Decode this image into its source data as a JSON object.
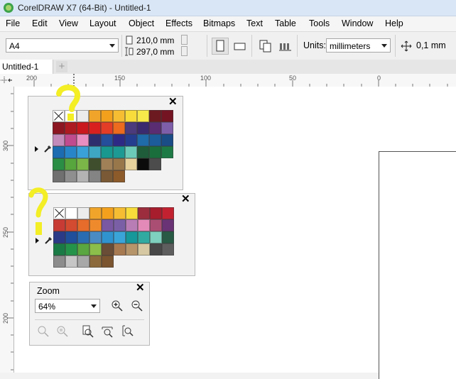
{
  "window": {
    "title": "CorelDRAW X7 (64-Bit) - Untitled-1"
  },
  "menu": [
    "File",
    "Edit",
    "View",
    "Layout",
    "Object",
    "Effects",
    "Bitmaps",
    "Text",
    "Table",
    "Tools",
    "Window",
    "Help"
  ],
  "propbar": {
    "page_size": "A4",
    "width": "210,0 mm",
    "height": "297,0 mm",
    "units_label": "Units:",
    "units_value": "millimeters",
    "nudge": "0,1 mm"
  },
  "doc_tab": {
    "label": "Untitled-1",
    "add": "+"
  },
  "ruler": {
    "h_labels": [
      "200",
      "150",
      "100",
      "50",
      "0"
    ],
    "v_labels": [
      "300",
      "250",
      "200"
    ]
  },
  "palette1": {
    "colors": [
      "none",
      "#ffffff",
      "#ececec",
      "#f0a52a",
      "#f3a11d",
      "#f6bd33",
      "#f8dc3b",
      "#f7e94a",
      "#6c1a20",
      "#741423",
      "#8c1622",
      "#ae1a21",
      "#c9191e",
      "#d9201f",
      "#e33d27",
      "#ec6b1e",
      "#4b3a7c",
      "#3a2a6e",
      "#5a2c72",
      "#7e5ea9",
      "#c28bba",
      "#c04b8e",
      "#e88ec0",
      "#2e2e6f",
      "#254e9b",
      "#2d2a86",
      "#243d8f",
      "#1f6aa8",
      "#1c5c9a",
      "#1a4c86",
      "#1b6cb0",
      "#2886c8",
      "#3aa0d8",
      "#3ea6c3",
      "#18988f",
      "#1e9a94",
      "#6ccbb8",
      "#1f5c3a",
      "#1a6e3c",
      "#1e7a45",
      "#2a8e44",
      "#57a53d",
      "#7ab648",
      "#3f4f2d",
      "#a08057",
      "#98774b",
      "#e6d19c",
      "#0b0b0b",
      "#4c4c4c",
      "",
      "#707070",
      "#8f8f8f",
      "#b3b3b3",
      "#848484",
      "#7a5a36",
      "#8d5a2a",
      "",
      "",
      "",
      ""
    ]
  },
  "palette2": {
    "colors": [
      "none",
      "#ffffff",
      "#ececec",
      "#f0a52a",
      "#f3a11d",
      "#f6bd33",
      "#f8dc3b",
      "#9b2d3c",
      "#a71d2d",
      "#c22230",
      "#c83b35",
      "#d34b30",
      "#e56c2b",
      "#ef8a2c",
      "#7a58a2",
      "#7b5fa6",
      "#b97db5",
      "#e48ab8",
      "#ab4e74",
      "#6a3375",
      "#2b3a86",
      "#1f4e9a",
      "#2a6cb1",
      "#4a8bc3",
      "#2f93cf",
      "#3aa4d8",
      "#16979a",
      "#31aba2",
      "#7fd0be",
      "#285a45",
      "#1a7a45",
      "#24934a",
      "#5aa640",
      "#8bbe4a",
      "#6a4d36",
      "#a87a52",
      "#b6956b",
      "#d6c8a2",
      "#484848",
      "#5e5e5e",
      "#8c8c8c",
      "#c6c6c6",
      "#a8a8a8",
      "#8c6a3c",
      "#7b5530",
      "",
      "",
      "",
      "",
      ""
    ]
  },
  "zoom": {
    "title": "Zoom",
    "value": "64%"
  },
  "icons": {
    "app": "coreldraw-icon",
    "dropper": "eyedropper-icon",
    "close": "close-icon",
    "flyout": "flyout-arrow-icon",
    "zoom_in": "zoom-in-icon",
    "zoom_out": "zoom-out-icon"
  }
}
